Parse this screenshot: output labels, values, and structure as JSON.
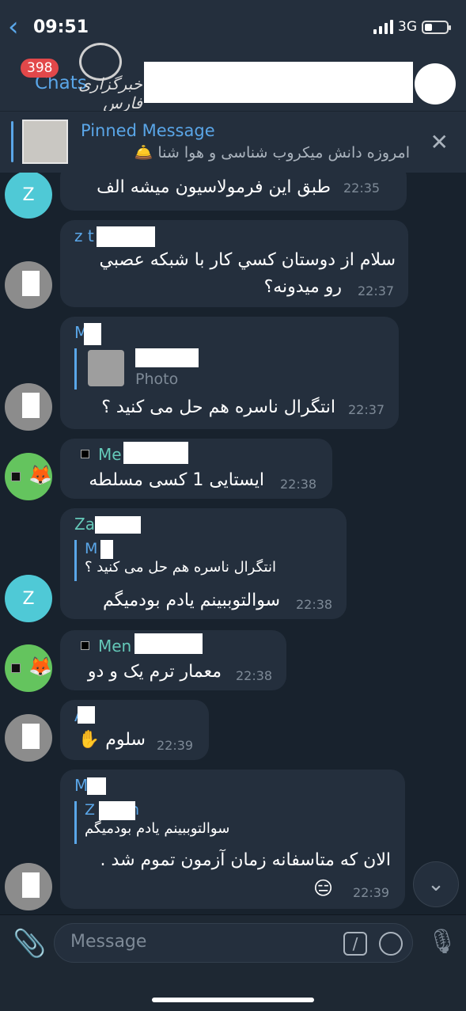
{
  "status_bar": {
    "time": "09:51",
    "network": "3G"
  },
  "header": {
    "back_label": "Chats",
    "unread_count": "398",
    "watermark_text": "خبرگزاری فارس"
  },
  "pinned": {
    "title": "Pinned Message",
    "text": "امروزه دانش میکروب شناسی  و هوا شنا 🛎️",
    "icon": "bell-icon"
  },
  "messages": [
    {
      "text": "طبق این فرمولاسیون میشه الف",
      "time": "22:35"
    },
    {
      "sender": "z t",
      "line1": "سلام از دوستان كسي كار با شبكه عصبي",
      "line2": "رو میدونه؟",
      "time": "22:37"
    },
    {
      "sender": "M",
      "reply_type": "Photo",
      "text": "انتگرال ناسره هم حل می کنید ؟",
      "time": "22:37"
    },
    {
      "sender": "Me",
      "text": "ایستایی 1 کسی مسلطه",
      "time": "22:38"
    },
    {
      "sender": "Za",
      "reply_name": "M",
      "reply_text": "انتگرال ناسره هم حل می کنید ؟",
      "text": "سوالتوببینم یادم بودمیگم",
      "time": "22:38"
    },
    {
      "sender": "Men",
      "text": "معمار ترم یک و دو",
      "time": "22:38"
    },
    {
      "sender": "A",
      "text": "سلوم ✋",
      "time": "22:39"
    },
    {
      "sender": "M",
      "reply_name": "Z",
      "reply_suffix": "n",
      "reply_text": "سوالتوببینم یادم بودمیگم",
      "line1": "الان که متاسفانه زمان آزمون تموم شد .",
      "line2": "😑",
      "time": "22:39"
    }
  ],
  "avatars": {
    "z_letter": "Z",
    "fox": "🦊"
  },
  "input": {
    "placeholder": "Message"
  },
  "colors": {
    "accent": "#5aa6e8",
    "background": "#18222d",
    "bubble": "#242f3d",
    "badge": "#e2484a"
  }
}
